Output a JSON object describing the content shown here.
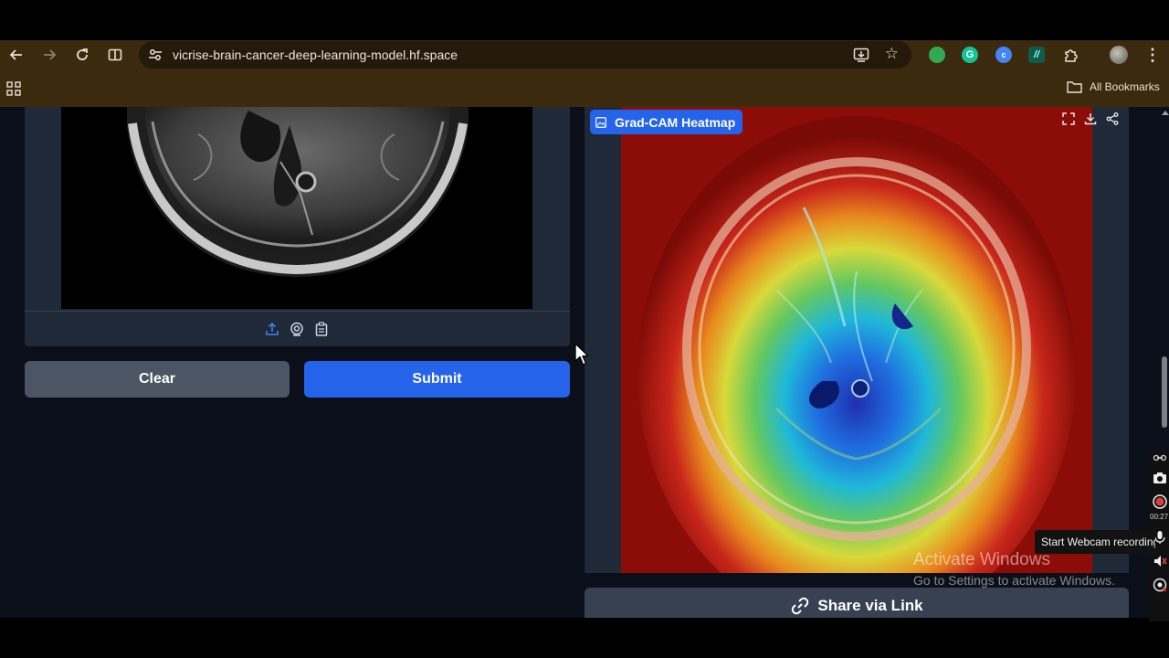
{
  "browser": {
    "url": "vicrise-brain-cancer-deep-learning-model.hf.space",
    "bookmarks_label": "All Bookmarks",
    "extensions": [
      {
        "name": "extension-green-icon",
        "color": "#33a852"
      },
      {
        "name": "grammarly-icon",
        "color": "#15c39a"
      },
      {
        "name": "extension-blue-icon",
        "color": "#4285f4"
      },
      {
        "name": "extension-teal-icon",
        "color": "#0f5c4a"
      }
    ]
  },
  "input": {
    "source_icons": [
      "upload-icon",
      "webcam-icon",
      "clipboard-icon"
    ]
  },
  "buttons": {
    "clear": "Clear",
    "submit": "Submit",
    "share": "Share via Link"
  },
  "output": {
    "label": "Grad-CAM Heatmap",
    "toolbar_icons": [
      "fullscreen-icon",
      "download-icon",
      "share-icon"
    ]
  },
  "watermark": {
    "title": "Activate Windows",
    "subtitle": "Go to Settings to activate Windows."
  },
  "recorder": {
    "time": "00:27",
    "tooltip": "Start Webcam recording"
  },
  "colors": {
    "accent": "#2563eb",
    "panel": "#1f2937",
    "page_bg": "#0b0f19",
    "browser_chrome": "#3b2a0d"
  }
}
